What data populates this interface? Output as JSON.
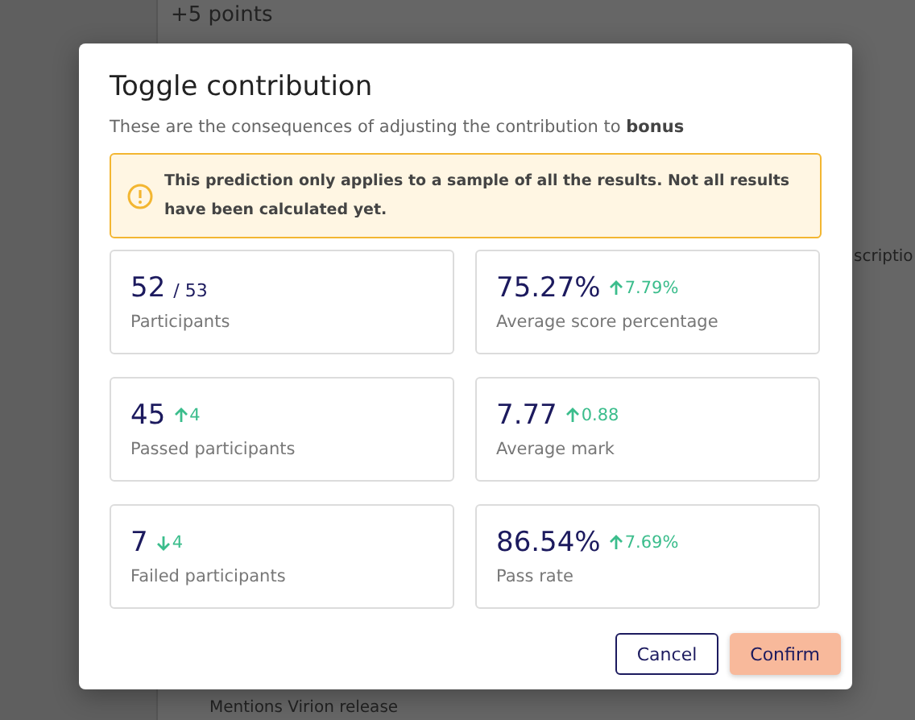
{
  "background": {
    "texts": [
      "+5 points",
      "scriptio",
      "Mentions Virion release"
    ]
  },
  "dialog": {
    "title": "Toggle contribution",
    "subtitle": "These are the consequences of adjusting the contribution to **bonus**",
    "warning": "This prediction only applies to a sample of all the results. Not all results have been calculated yet.",
    "stats": [
      {
        "value": "52",
        "total": "/ 53",
        "label": "Participants"
      },
      {
        "value": "75.27%",
        "change": {
          "kind": "up",
          "text": "7.79%"
        },
        "label": "Average score percentage"
      },
      {
        "value": "45",
        "change": {
          "kind": "up",
          "text": "4"
        },
        "label": "Passed participants"
      },
      {
        "value": "7.77",
        "change": {
          "kind": "up",
          "text": "0.88"
        },
        "label": "Average mark"
      },
      {
        "value": "7",
        "change": {
          "kind": "down",
          "text": "4"
        },
        "label": "Failed participants"
      },
      {
        "value": "86.54%",
        "change": {
          "kind": "up",
          "text": "7.69%"
        },
        "label": "Pass rate"
      }
    ],
    "buttons": [
      {
        "label": "Cancel",
        "kind": "secondary"
      },
      {
        "label": "Confirm",
        "kind": "primary"
      }
    ]
  }
}
